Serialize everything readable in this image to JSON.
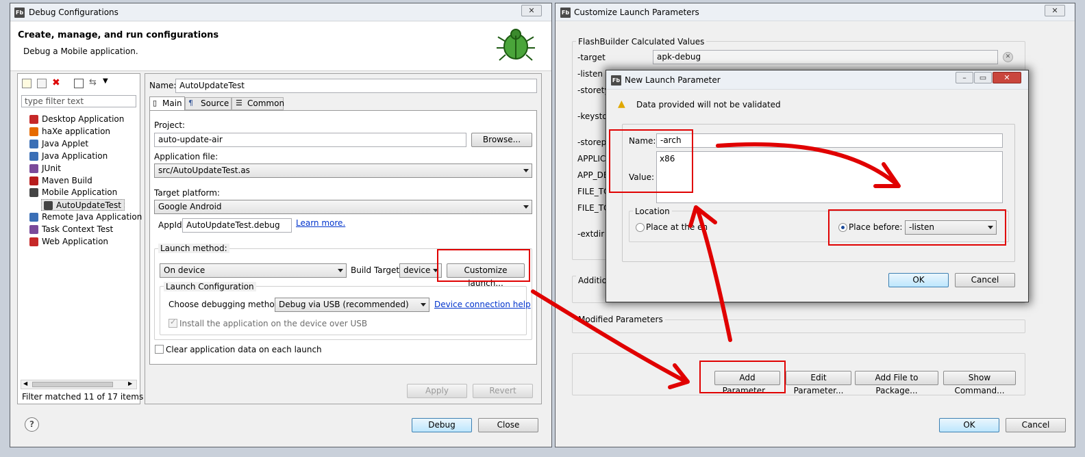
{
  "debug_window": {
    "title": "Debug Configurations",
    "header_title": "Create, manage, and run configurations",
    "header_subtitle": "Debug a Mobile application.",
    "filter_placeholder": "type filter text",
    "tree_items": [
      {
        "label": "Desktop Application",
        "icon": "desktop-app-icon",
        "level": 0
      },
      {
        "label": "haXe application",
        "icon": "haxe-icon",
        "level": 0
      },
      {
        "label": "Java Applet",
        "icon": "java-applet-icon",
        "level": 0
      },
      {
        "label": "Java Application",
        "icon": "java-app-icon",
        "level": 0
      },
      {
        "label": "JUnit",
        "icon": "junit-icon",
        "level": 0
      },
      {
        "label": "Maven Build",
        "icon": "maven-icon",
        "level": 0
      },
      {
        "label": "Mobile Application",
        "icon": "mobile-app-icon",
        "level": 0
      },
      {
        "label": "AutoUpdateTest",
        "icon": "mobile-config-icon",
        "level": 1
      },
      {
        "label": "Remote Java Application",
        "icon": "remote-java-icon",
        "level": 0
      },
      {
        "label": "Task Context Test",
        "icon": "task-context-icon",
        "level": 0
      },
      {
        "label": "Web Application",
        "icon": "web-app-icon",
        "level": 0
      }
    ],
    "filter_status": "Filter matched 11 of 17 items",
    "name_label": "Name:",
    "name_value": "AutoUpdateTest",
    "tabs": [
      "Main",
      "Source",
      "Common"
    ],
    "project_label": "Project:",
    "project_value": "auto-update-air",
    "browse_label": "Browse...",
    "app_file_label": "Application file:",
    "app_file_value": "src/AutoUpdateTest.as",
    "target_platform_label": "Target platform:",
    "target_platform_value": "Google Android",
    "appid_label": "AppId",
    "appid_value": "AutoUpdateTest.debug",
    "learn_more": "Learn more.",
    "launch_method_label": "Launch method:",
    "launch_method_value": "On device",
    "build_target_label": "Build Target:",
    "build_target_value": "device",
    "customize_label": "Customize launch...",
    "launch_config_label": "Launch Configuration",
    "debug_method_label": "Choose debugging method:",
    "debug_method_value": "Debug via USB (recommended)",
    "device_help": "Device connection help",
    "install_label": "Install the application on the device over USB",
    "clear_label": "Clear application data on each launch",
    "apply_label": "Apply",
    "revert_label": "Revert",
    "debug_label": "Debug",
    "close_label": "Close",
    "help_icon": "?"
  },
  "customize_window": {
    "title": "Customize Launch Parameters",
    "calc_group": "FlashBuilder Calculated Values",
    "params": [
      "-target",
      "-listen",
      "-storety",
      "-keysto",
      "-storepa",
      "APPLICA",
      "APP_DE",
      "FILE_TO",
      "FILE_TO",
      "-extdir"
    ],
    "target_value": "apk-debug",
    "additional_label": "Additio",
    "modified_group": "Modified Parameters",
    "add_param": "Add Parameter...",
    "edit_param": "Edit Parameter...",
    "add_file": "Add File to Package...",
    "show_command": "Show Command...",
    "ok_label": "OK",
    "cancel_label": "Cancel"
  },
  "new_param_dialog": {
    "title": "New Launch Parameter",
    "warning": "Data provided will not be validated",
    "name_label": "Name:",
    "name_value": "-arch",
    "value_label": "Value:",
    "value_value": "x86",
    "location_label": "Location",
    "place_end_label": "Place at the en",
    "place_before_label": "Place before:",
    "place_before_value": "-listen",
    "ok_label": "OK",
    "cancel_label": "Cancel"
  }
}
